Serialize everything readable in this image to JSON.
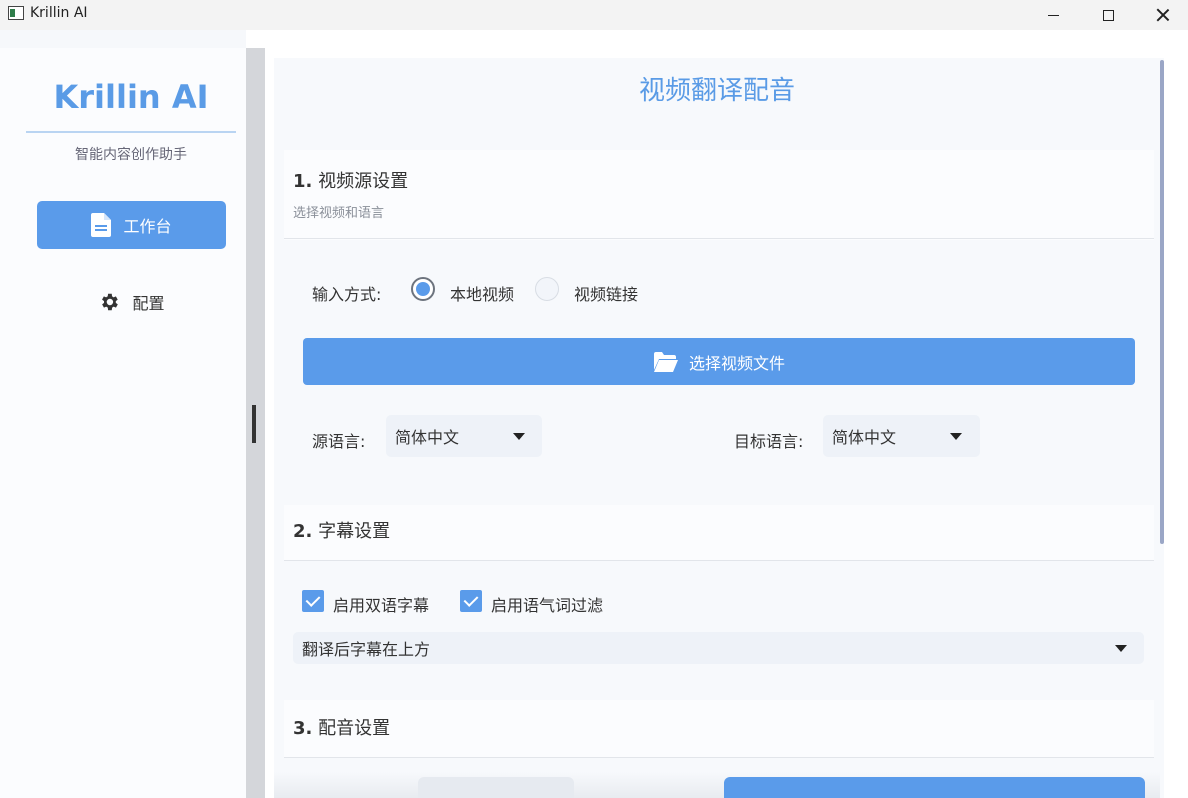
{
  "window": {
    "title": "Krillin AI"
  },
  "sidebar": {
    "brand": "Krillin AI",
    "subtitle": "智能内容创作助手",
    "items": [
      {
        "label": "工作台",
        "icon": "document-icon",
        "active": true
      },
      {
        "label": "配置",
        "icon": "gear-icon",
        "active": false
      }
    ]
  },
  "main": {
    "title": "视频翻译配音",
    "section1": {
      "number": "1.",
      "title": "视频源设置",
      "subtitle": "选择视频和语言",
      "input_method_label": "输入方式:",
      "options": [
        {
          "label": "本地视频",
          "selected": true
        },
        {
          "label": "视频链接",
          "selected": false
        }
      ],
      "pick_button": "选择视频文件",
      "source_label": "源语言:",
      "source_value": "简体中文",
      "target_label": "目标语言:",
      "target_value": "简体中文"
    },
    "section2": {
      "number": "2.",
      "title": "字幕设置",
      "checkboxes": [
        {
          "label": "启用双语字幕",
          "checked": true
        },
        {
          "label": "启用语气词过滤",
          "checked": true
        }
      ],
      "position_value": "翻译后字幕在上方"
    },
    "section3": {
      "number": "3.",
      "title": "配音设置"
    }
  },
  "colors": {
    "accent": "#5a9bea",
    "brand": "#5a9be6"
  }
}
